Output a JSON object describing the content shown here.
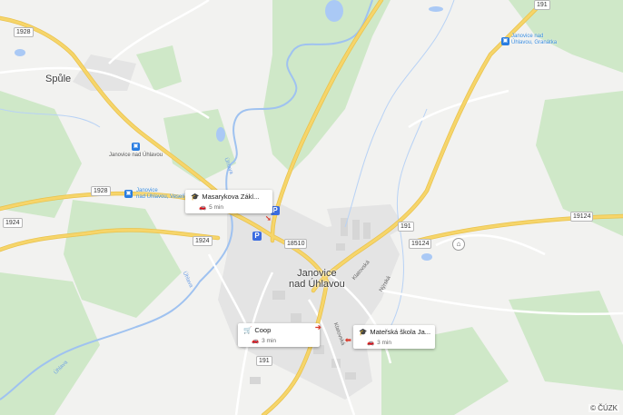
{
  "towns": {
    "spule": "Spůle",
    "janovice": "Janovice\nnad Úhlavou"
  },
  "stops": {
    "stop1": "Janovice nad Úhlavou",
    "stop2": "Janovice\nnad Úhlavou, Veselí",
    "stop3": "Janovice nad\nÚhlavou, Granátka"
  },
  "rivers": {
    "r1": "Úhlava",
    "r2": "Úhlava",
    "r3": "Úhlava"
  },
  "streets": {
    "klatovska1": "Klatovská",
    "nyrska": "Nýrská",
    "klatovska2": "Klatovská"
  },
  "roads": {
    "r1928a": "1928",
    "r1928b": "1928",
    "r1924a": "1924",
    "r1924b": "1924",
    "r191a": "191",
    "r191b": "191",
    "r191c": "191",
    "r18510": "18510",
    "r19124a": "19124",
    "r19124b": "19124"
  },
  "cards": {
    "school": {
      "title": "Masarykova Zákl...",
      "time": "5 min"
    },
    "coop": {
      "title": "Coop",
      "time": "3 min"
    },
    "kindergarten": {
      "title": "Mateřská škola Ja...",
      "time": "3 min"
    }
  },
  "icons": {
    "bus": "bus-stop-icon",
    "parking": "parking-icon",
    "school": "graduation-cap-icon",
    "cart": "shopping-cart-icon",
    "car": "car-icon"
  },
  "colors": {
    "road_major": "#f6d56a",
    "water": "#aac9f5",
    "forest": "#c9e6c2",
    "land": "#f2f2f0",
    "built": "#e6e6e6"
  },
  "copyright": "© ČÚZK"
}
